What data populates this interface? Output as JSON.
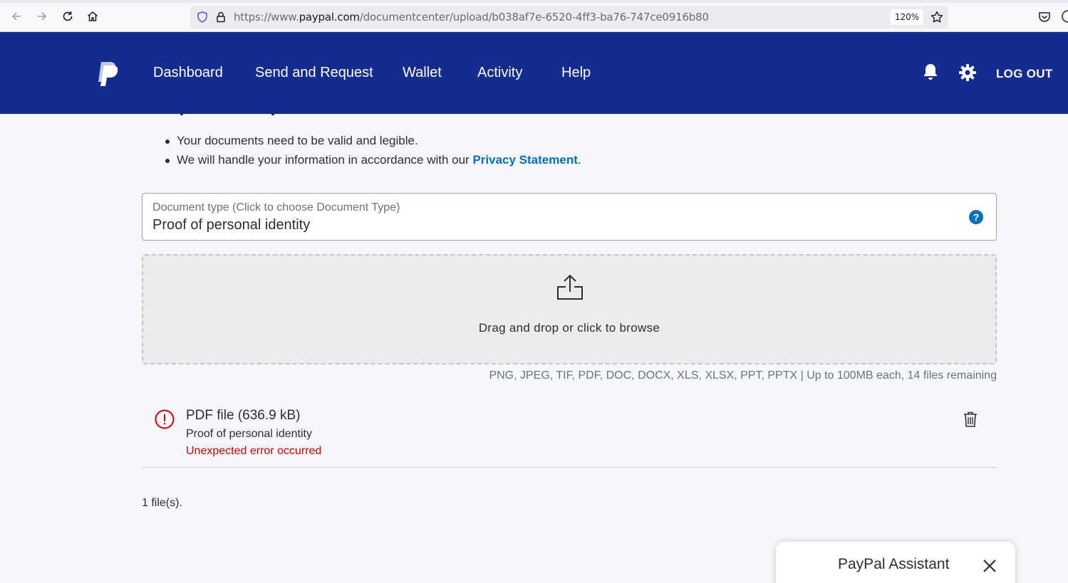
{
  "browser": {
    "url_prefix": "https://www.",
    "url_domain": "paypal.com",
    "url_path": "/documentcenter/upload/b038af7e-6520-4ff3-ba76-747ce0916b80",
    "zoom": "120%",
    "icons": [
      "back-icon",
      "forward-icon",
      "reload-icon",
      "home-icon",
      "shield-icon",
      "lock-icon",
      "star-icon",
      "pocket-icon"
    ]
  },
  "header": {
    "nav": [
      "Dashboard",
      "Send and Request",
      "Wallet",
      "Activity",
      "Help"
    ],
    "logout": "LOG OUT",
    "bg_color": "#142c8e"
  },
  "content": {
    "bullets": [
      "Your documents need to be valid and legible.",
      "We will handle your information in accordance with our "
    ],
    "privacy_link": "Privacy Statement",
    "privacy_suffix": "."
  },
  "doc_type": {
    "label": "Document type (Click to choose Document Type)",
    "value": "Proof of personal identity",
    "help": "?"
  },
  "dropzone": {
    "text": "Drag and drop or click to browse",
    "formats": "PNG, JPEG, TIF, PDF, DOC, DOCX, XLS, XLSX, PPT, PPTX | Up to 100MB each, 14 files remaining"
  },
  "file": {
    "name": "PDF file (636.9 kB)",
    "type": "Proof of personal identity",
    "error": "Unexpected error occurred"
  },
  "file_count": "1 file(s).",
  "assistant": {
    "title": "PayPal Assistant"
  },
  "colors": {
    "link": "#0070ba",
    "error": "#d20000"
  }
}
